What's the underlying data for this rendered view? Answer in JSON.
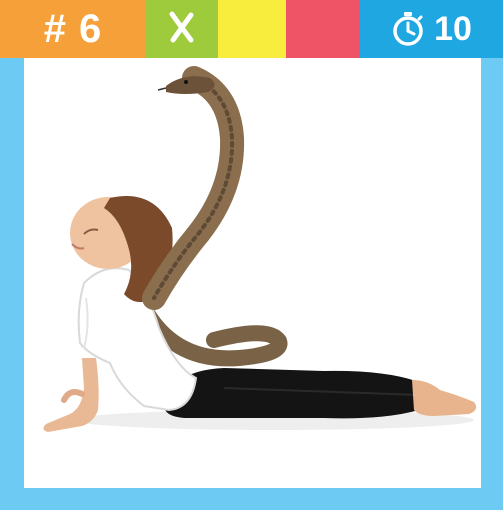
{
  "topbar": {
    "pose_number": "# 6",
    "timer_value": "10",
    "colors": {
      "number_bg": "#f6a03a",
      "x_bg": "#9dcb3c",
      "yellow_bg": "#f8ec3c",
      "red_bg": "#ef5466",
      "timer_bg": "#1ea7e1",
      "frame": "#6dcaf2"
    },
    "icons": {
      "x": "close-x-icon",
      "timer": "stopwatch-icon"
    }
  },
  "illustration": {
    "subject": "cobra-pose-child-with-cobra-snake"
  }
}
